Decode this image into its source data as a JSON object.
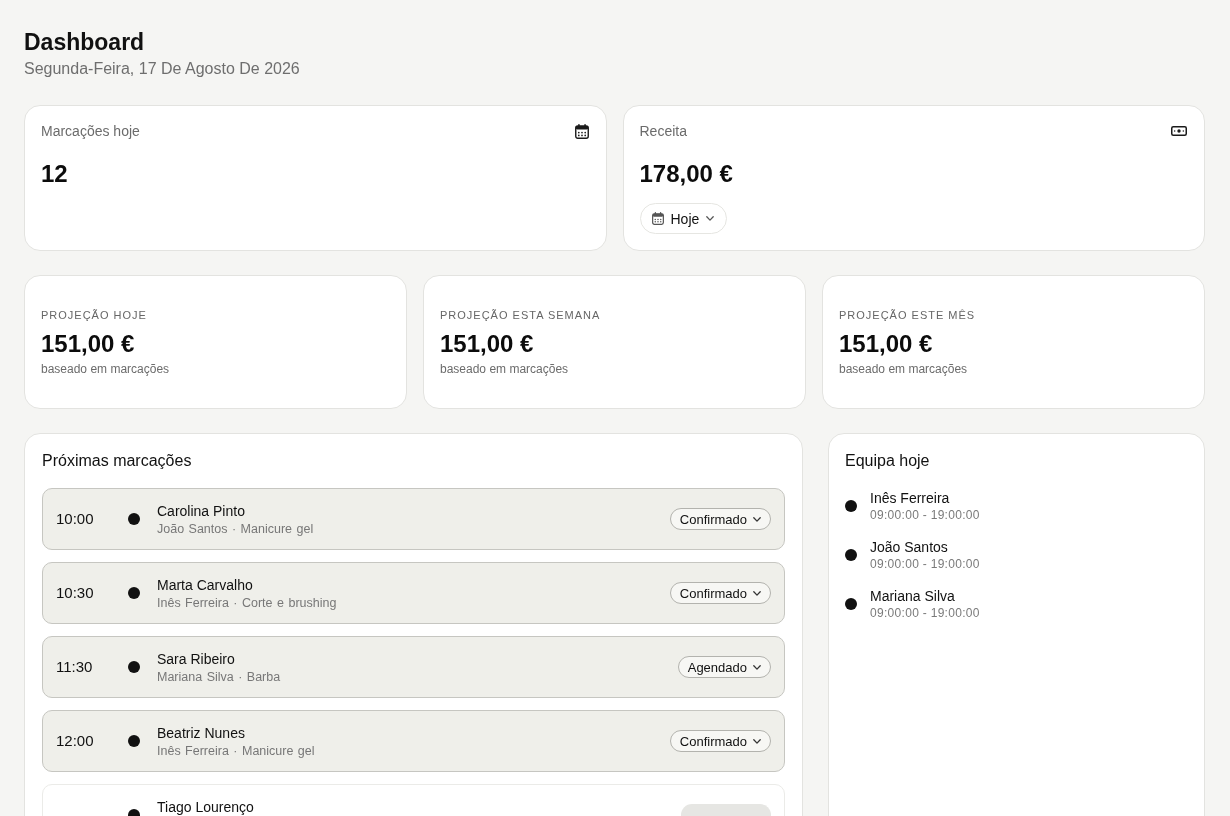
{
  "header": {
    "title": "Dashboard",
    "date": "Segunda-Feira, 17 De Agosto De 2026"
  },
  "summary_cards": [
    {
      "kind": "appointments",
      "label": "Marcações hoje",
      "value": "12"
    },
    {
      "kind": "revenue",
      "label": "Receita",
      "value": "178,00 €",
      "period_filter": {
        "label": "Hoje"
      }
    }
  ],
  "projections": [
    {
      "label": "PROJEÇÃO HOJE",
      "value": "151,00 €",
      "note": "baseado em marcações"
    },
    {
      "label": "PROJEÇÃO ESTA SEMANA",
      "value": "151,00 €",
      "note": "baseado em marcações"
    },
    {
      "label": "PROJEÇÃO ESTE MÊS",
      "value": "151,00 €",
      "note": "baseado em marcações"
    }
  ],
  "appointments": {
    "title": "Próximas marcações",
    "items": [
      {
        "time": "10:00",
        "client": "Carolina Pinto",
        "details": "João Santos · Manicure gel",
        "status": "Confirmado",
        "highlighted": true
      },
      {
        "time": "10:30",
        "client": "Marta Carvalho",
        "details": "Inês Ferreira · Corte e brushing",
        "status": "Confirmado",
        "highlighted": true
      },
      {
        "time": "11:30",
        "client": "Sara Ribeiro",
        "details": "Mariana Silva · Barba",
        "status": "Agendado",
        "highlighted": true
      },
      {
        "time": "12:00",
        "client": "Beatriz Nunes",
        "details": "Inês Ferreira · Manicure gel",
        "status": "Confirmado",
        "highlighted": true
      },
      {
        "client": "Tiago Lourenço",
        "highlighted": false
      }
    ]
  },
  "team": {
    "title": "Equipa hoje",
    "members": [
      {
        "name": "Inês Ferreira",
        "hours": "09:00:00 - 19:00:00"
      },
      {
        "name": "João Santos",
        "hours": "09:00:00 - 19:00:00"
      },
      {
        "name": "Mariana Silva",
        "hours": "09:00:00 - 19:00:00"
      }
    ]
  }
}
